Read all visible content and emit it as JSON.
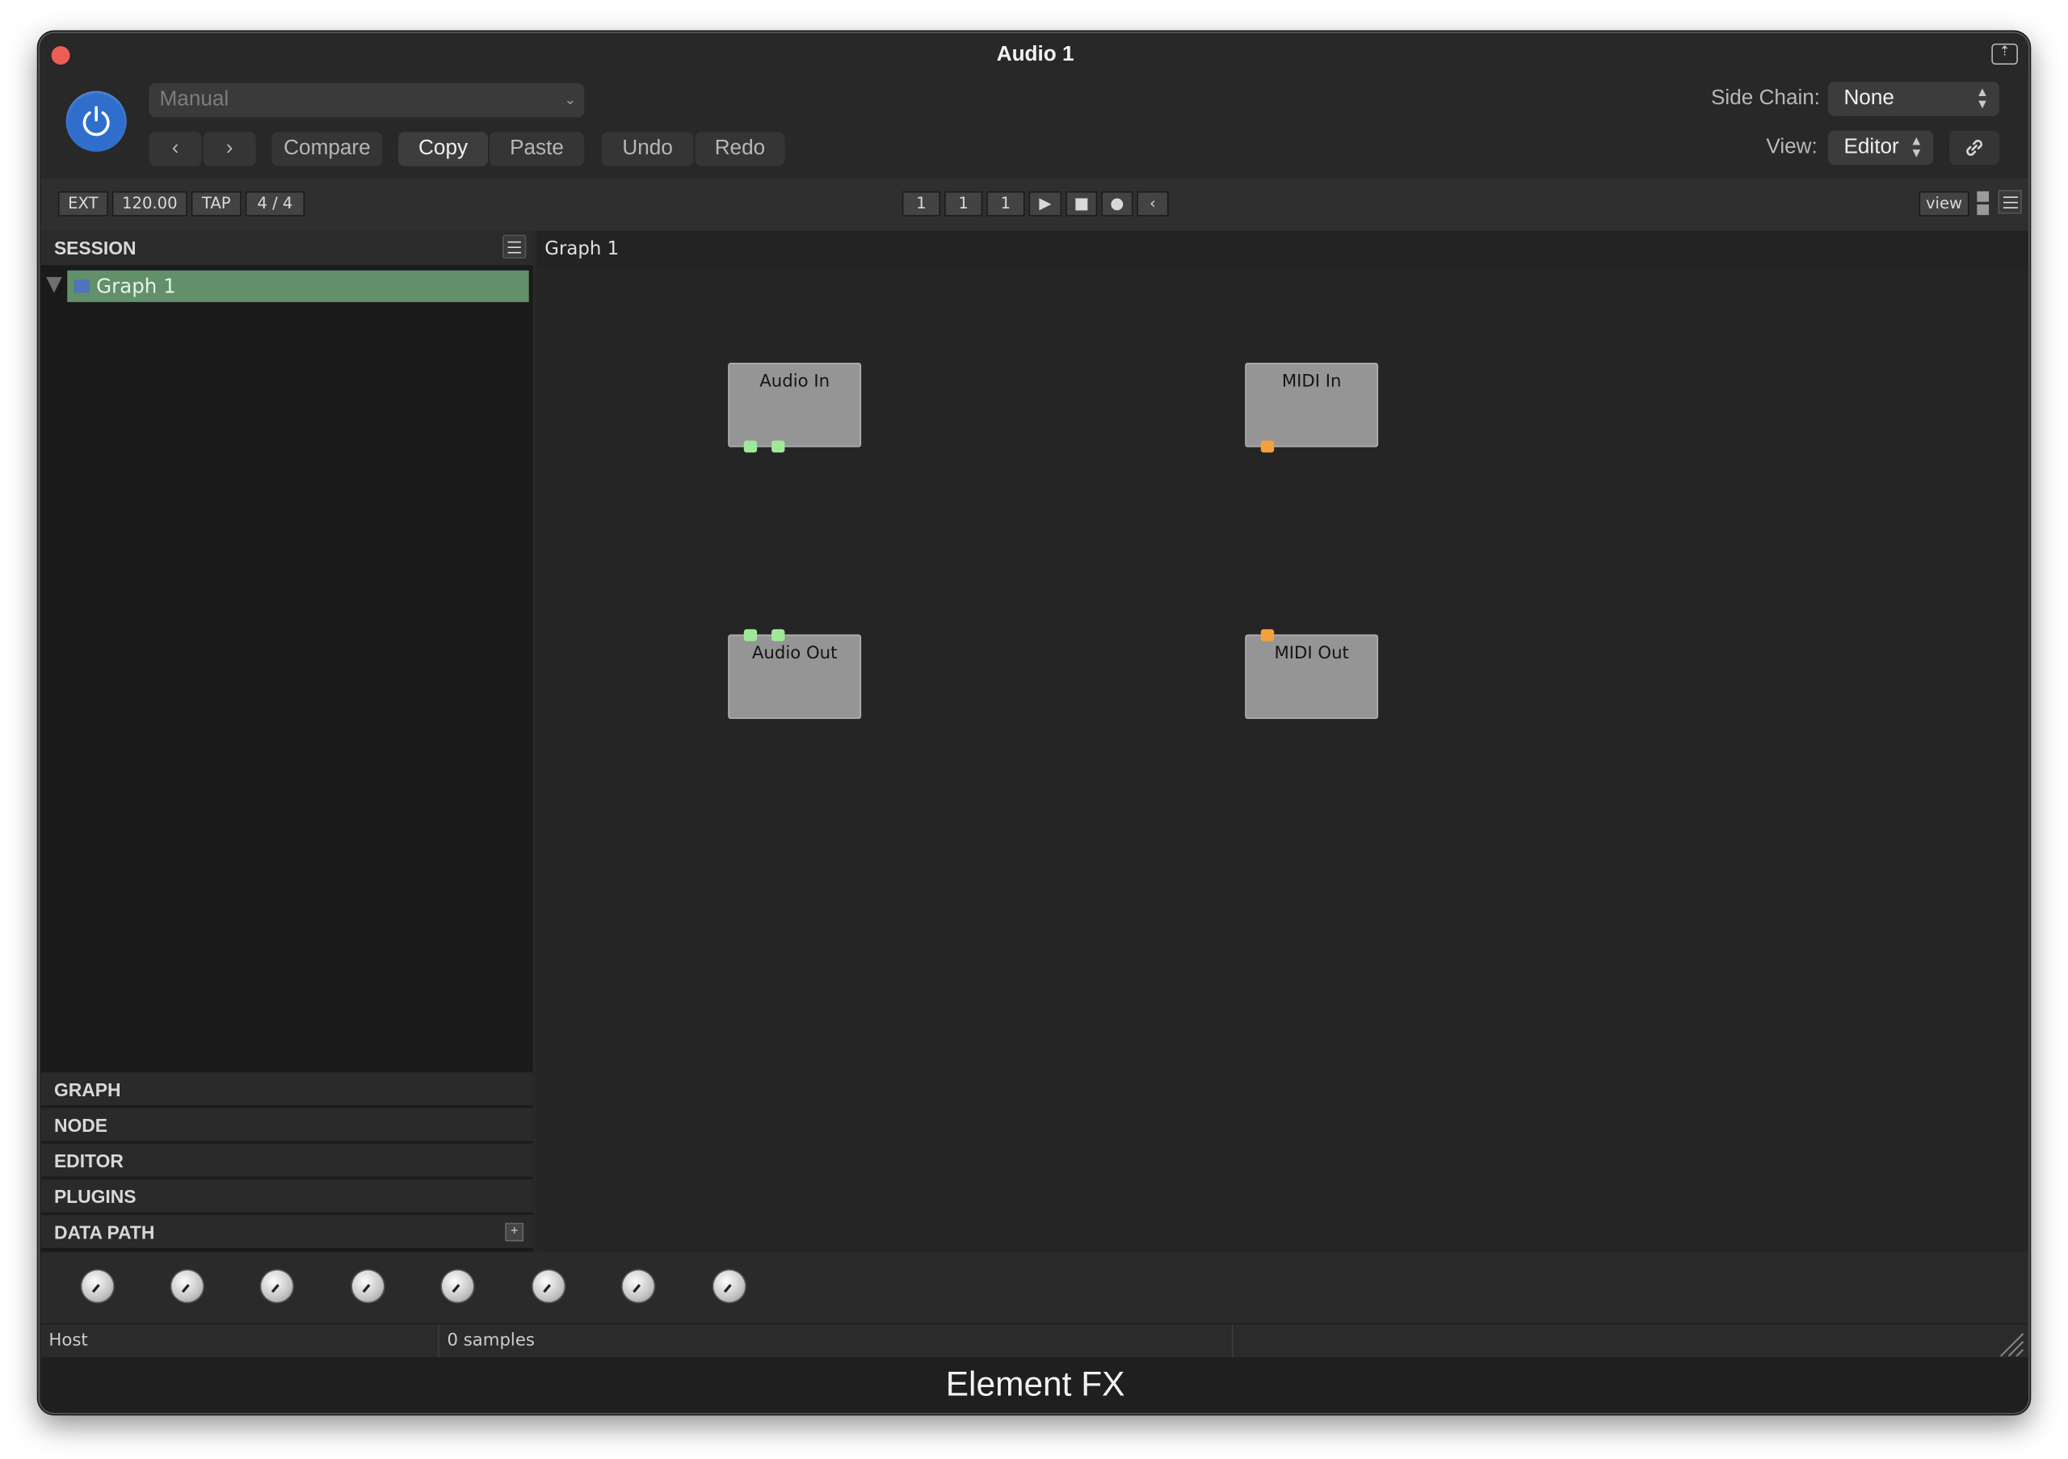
{
  "window": {
    "title": "Audio 1"
  },
  "header": {
    "preset_value": "Manual",
    "compare_label": "Compare",
    "copy_label": "Copy",
    "paste_label": "Paste",
    "undo_label": "Undo",
    "redo_label": "Redo",
    "sidechain_label": "Side Chain:",
    "sidechain_value": "None",
    "view_label": "View:",
    "view_value": "Editor"
  },
  "transport": {
    "ext": "EXT",
    "tempo": "120.00",
    "tap": "TAP",
    "time_signature": "4 / 4",
    "position": [
      "1",
      "1",
      "1"
    ],
    "view_button": "view"
  },
  "sidebar": {
    "session_label": "SESSION",
    "tree": [
      {
        "label": "Graph 1",
        "selected": true
      }
    ],
    "sections": [
      "GRAPH",
      "NODE",
      "EDITOR",
      "PLUGINS",
      "DATA PATH"
    ]
  },
  "graph": {
    "title": "Graph 1",
    "nodes": [
      {
        "name": "Audio In",
        "ports": "audio",
        "port_count": 2,
        "port_side": "bottom"
      },
      {
        "name": "MIDI In",
        "ports": "midi",
        "port_count": 1,
        "port_side": "bottom"
      },
      {
        "name": "Audio Out",
        "ports": "audio",
        "port_count": 2,
        "port_side": "top"
      },
      {
        "name": "MIDI Out",
        "ports": "midi",
        "port_count": 1,
        "port_side": "top"
      }
    ]
  },
  "knobs": {
    "count": 8
  },
  "status": {
    "host_label": "Host",
    "samples": "0 samples"
  },
  "footer": {
    "brand": "Element FX"
  },
  "colors": {
    "power": "#2f6ecb",
    "selected_tree_row": "#62906a",
    "audio_port": "#9fe89a",
    "midi_port": "#f5a03c",
    "close_button": "#ed5e57"
  },
  "icons": [
    "power-icon",
    "chevron-left-icon",
    "chevron-right-icon",
    "link-icon",
    "play-icon",
    "stop-icon",
    "record-icon",
    "rewind-icon",
    "grid-icon",
    "list-icon",
    "menu-icon",
    "graph-icon",
    "plus-icon",
    "resize-grip-icon",
    "popout-icon"
  ]
}
